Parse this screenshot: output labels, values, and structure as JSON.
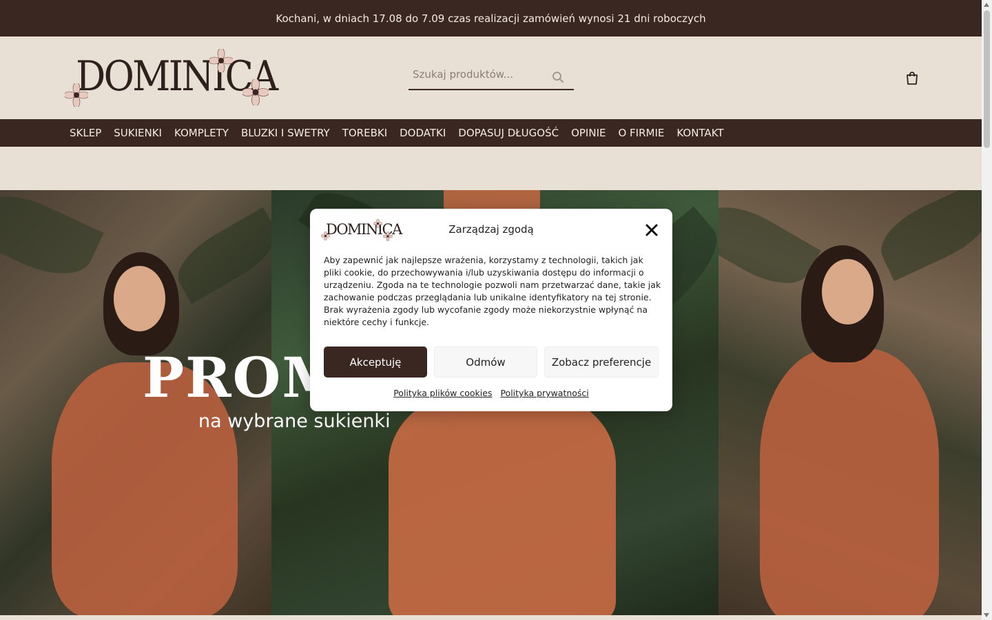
{
  "announcement": "Kochani, w dniach 17.08 do 7.09 czas realizacji zamówień wynosi 21 dni roboczych",
  "header": {
    "logo_text": "DOMINICA",
    "search_placeholder": "Szukaj produktów...",
    "search_icon": "search-icon",
    "cart_icon": "shopping-bag-icon"
  },
  "nav": {
    "items": [
      "SKLEP",
      "SUKIENKI",
      "KOMPLETY",
      "BLUZKI I SWETRY",
      "TOREBKI",
      "DODATKI",
      "DOPASUJ DŁUGOŚĆ",
      "OPINIE",
      "O FIRMIE",
      "KONTAKT"
    ]
  },
  "hero": {
    "title": "PROMO",
    "subtitle": "na wybrane sukienki"
  },
  "consent": {
    "logo_text": "DOMINICA",
    "title": "Zarządzaj zgodą",
    "text": "Aby zapewnić jak najlepsze wrażenia, korzystamy z technologii, takich jak pliki cookie, do przechowywania i/lub uzyskiwania dostępu do informacji o urządzeniu. Zgoda na te technologie pozwoli nam przetwarzać dane, takie jak zachowanie podczas przeglądania lub unikalne identyfikatory na tej stronie. Brak wyrażenia zgody lub wycofanie zgody może niekorzystnie wpłynąć na niektóre cechy i funkcje.",
    "accept_label": "Akceptuję",
    "deny_label": "Odmów",
    "prefs_label": "Zobacz preferencje",
    "cookie_policy_label": "Polityka plików cookies",
    "privacy_policy_label": "Polityka prywatności",
    "close_icon": "close-icon"
  },
  "colors": {
    "brand_dark": "#3a2722",
    "background": "#e9e0d5"
  }
}
